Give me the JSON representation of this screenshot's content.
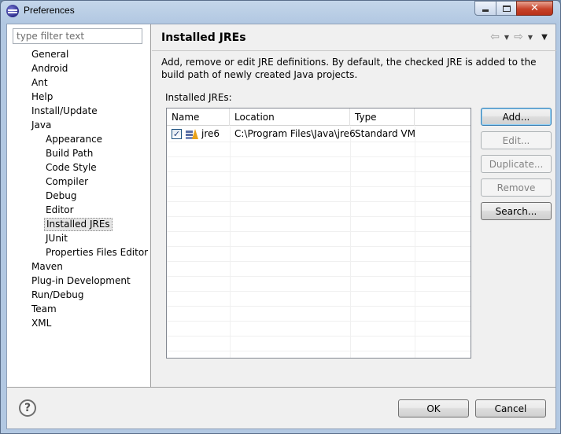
{
  "window": {
    "title": "Preferences"
  },
  "filter": {
    "placeholder": "type filter text"
  },
  "tree": [
    {
      "label": "General",
      "level": 0
    },
    {
      "label": "Android",
      "level": 0
    },
    {
      "label": "Ant",
      "level": 0
    },
    {
      "label": "Help",
      "level": 0
    },
    {
      "label": "Install/Update",
      "level": 0
    },
    {
      "label": "Java",
      "level": 0
    },
    {
      "label": "Appearance",
      "level": 1
    },
    {
      "label": "Build Path",
      "level": 1
    },
    {
      "label": "Code Style",
      "level": 1
    },
    {
      "label": "Compiler",
      "level": 1
    },
    {
      "label": "Debug",
      "level": 1
    },
    {
      "label": "Editor",
      "level": 1
    },
    {
      "label": "Installed JREs",
      "level": 1,
      "selected": true
    },
    {
      "label": "JUnit",
      "level": 1
    },
    {
      "label": "Properties Files Editor",
      "level": 1
    },
    {
      "label": "Maven",
      "level": 0
    },
    {
      "label": "Plug-in Development",
      "level": 0
    },
    {
      "label": "Run/Debug",
      "level": 0
    },
    {
      "label": "Team",
      "level": 0
    },
    {
      "label": "XML",
      "level": 0
    }
  ],
  "page": {
    "title": "Installed JREs",
    "description": "Add, remove or edit JRE definitions. By default, the checked JRE is added to the build path of newly created Java projects.",
    "list_label": "Installed JREs:"
  },
  "table": {
    "columns": [
      "Name",
      "Location",
      "Type"
    ],
    "rows": [
      {
        "checked": true,
        "name": "jre6",
        "location": "C:\\Program Files\\Java\\jre6",
        "type": "Standard VM"
      }
    ]
  },
  "buttons": {
    "add": "Add...",
    "edit": "Edit...",
    "duplicate": "Duplicate...",
    "remove": "Remove",
    "search": "Search...",
    "ok": "OK",
    "cancel": "Cancel"
  },
  "icons": {
    "help": "?",
    "check": "✓"
  },
  "colors": {
    "titlebar": "#b9cde5",
    "close_button": "#c7432a",
    "default_button_border": "#3c7fb1"
  }
}
